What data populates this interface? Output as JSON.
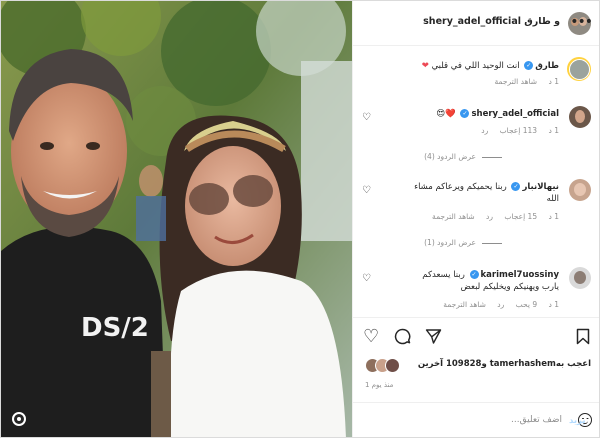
{
  "header": {
    "title": "shery_adel_official و طارق",
    "more_label": "•••"
  },
  "caption": {
    "user": "طارق",
    "text": "انت الوحيد اللي في قلبي",
    "emoji": "❤",
    "see_translation": "شاهد الترجمة",
    "time": "1 د"
  },
  "comments": [
    {
      "user": "shery_adel_official",
      "text": "😍❤️",
      "time": "1 د",
      "likes": "113 إعجاب",
      "reply": "رد",
      "replies_label": "عرض الردود (4)"
    },
    {
      "user": "نيهالانبار",
      "text": "ربنا يحميكم ويرعاكم مشاء الله",
      "time": "1 د",
      "likes": "15 إعجاب",
      "reply": "رد",
      "see_translation": "شاهد الترجمة",
      "replies_label": "عرض الردود (1)"
    },
    {
      "user": "karimel7uossiny",
      "text": "ربنا يسعدكم يارب ويهنيكم ويخليكم لبعض",
      "time": "1 د",
      "likes": "9 يحب",
      "reply": "رد",
      "see_translation": "شاهد الترجمة"
    }
  ],
  "actions": {
    "like": "♡",
    "comment": "comment",
    "share": "share",
    "save": "save"
  },
  "likes_text": "اعجب بهtamerhashem و109828 آخرين",
  "date": "منذ يوم 1",
  "add_comment": {
    "placeholder": "اضف تعليق...",
    "post_label": "يريد"
  },
  "colors": {
    "accent": "#3897f0",
    "heart": "#ed4956"
  }
}
